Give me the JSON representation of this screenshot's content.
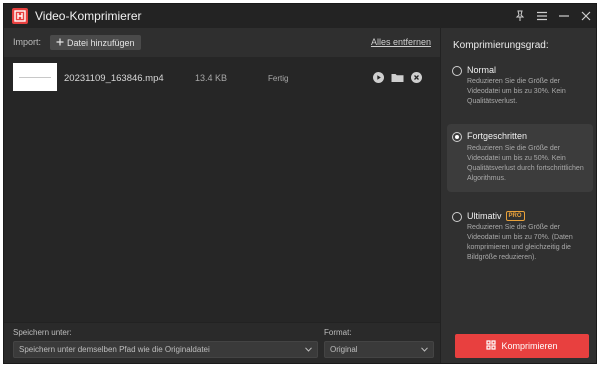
{
  "window": {
    "title": "Video-Komprimierer"
  },
  "import": {
    "label": "Import:",
    "add_button": "Datei hinzufügen",
    "remove_all": "Alles entfernen"
  },
  "files": [
    {
      "name": "20231109_163846.mp4",
      "size": "13.4 KB",
      "status": "Fertig"
    }
  ],
  "compression": {
    "heading": "Komprimierungsgrad:",
    "selected": "Fortgeschritten",
    "options": [
      {
        "title": "Normal",
        "description": "Reduzieren Sie die Größe der Videodatei um bis zu 30%. Kein Qualitätsverlust.",
        "badge": ""
      },
      {
        "title": "Fortgeschritten",
        "description": "Reduzieren Sie die Größe der Videodatei um bis zu 50%. Kein Qualitätsverlust durch fortschrittlichen Algorithmus.",
        "badge": ""
      },
      {
        "title": "Ultimativ",
        "description": "Reduzieren Sie die Größe der Videodatei um bis zu 70%. (Daten komprimieren und gleichzeitig die Bildgröße reduzieren).",
        "badge": "PRO"
      }
    ]
  },
  "output": {
    "save_label": "Speichern unter:",
    "save_value": "Speichern unter demselben Pfad wie die Originaldatei",
    "format_label": "Format:",
    "format_value": "Original"
  },
  "actions": {
    "compress": "Komprimieren"
  },
  "icons": {
    "app": "app-logo-icon",
    "pin": "pin-icon",
    "menu": "hamburger-menu-icon",
    "minimize": "minimize-icon",
    "close": "close-icon",
    "plus": "plus-icon",
    "play": "play-icon",
    "folder": "folder-icon",
    "remove": "remove-circle-icon",
    "chevron": "chevron-down-icon",
    "compress": "compress-icon"
  },
  "colors": {
    "accent": "#e8403f",
    "pro_badge": "#e8a13a",
    "window_bg": "#2c2c2c"
  }
}
